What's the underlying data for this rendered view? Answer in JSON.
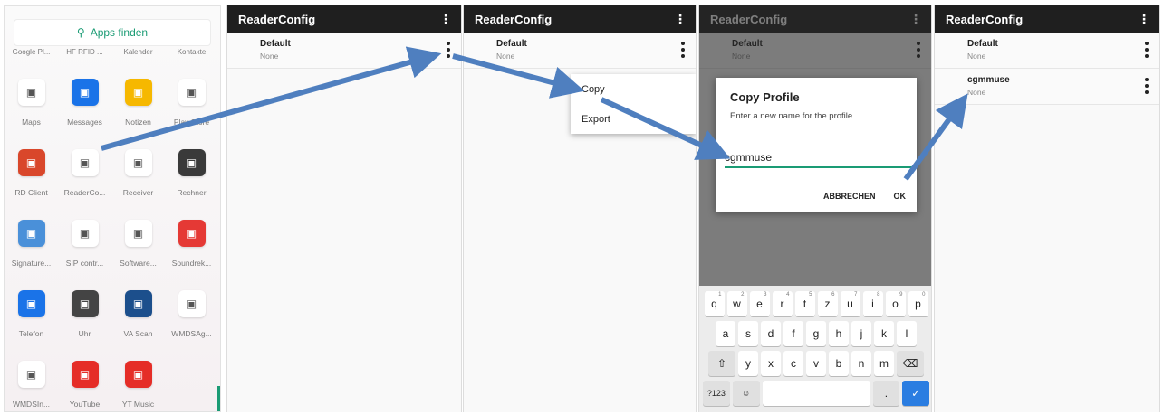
{
  "launcher": {
    "search_label": "Apps finden",
    "top_row": [
      "Google Pl...",
      "HF RFID ...",
      "Kalender",
      "Kontakte"
    ],
    "apps": [
      {
        "label": "Maps",
        "icon": "maps-icon",
        "color": "#ffffff"
      },
      {
        "label": "Messages",
        "icon": "messages-icon",
        "color": "#1a73e8"
      },
      {
        "label": "Notizen",
        "icon": "notes-icon",
        "color": "#f6b800"
      },
      {
        "label": "Play Store",
        "icon": "play-store-icon",
        "color": "#ffffff"
      },
      {
        "label": "RD Client",
        "icon": "rd-client-icon",
        "color": "#d9472b"
      },
      {
        "label": "ReaderCo...",
        "icon": "readerconfig-icon",
        "color": "#ffffff"
      },
      {
        "label": "Receiver",
        "icon": "receiver-icon",
        "color": "#ffffff"
      },
      {
        "label": "Rechner",
        "icon": "calculator-icon",
        "color": "#3a3a3a"
      },
      {
        "label": "Signature...",
        "icon": "signature-icon",
        "color": "#4a90d9"
      },
      {
        "label": "SIP contr...",
        "icon": "sip-icon",
        "color": "#ffffff"
      },
      {
        "label": "Software...",
        "icon": "software-icon",
        "color": "#ffffff"
      },
      {
        "label": "Soundrek...",
        "icon": "recorder-icon",
        "color": "#e53935"
      },
      {
        "label": "Telefon",
        "icon": "phone-icon",
        "color": "#1a73e8"
      },
      {
        "label": "Uhr",
        "icon": "clock-icon",
        "color": "#444444"
      },
      {
        "label": "VA Scan",
        "icon": "va-scan-icon",
        "color": "#1c4f8c"
      },
      {
        "label": "WMDSAg...",
        "icon": "wmds-agent-icon",
        "color": "#ffffff"
      },
      {
        "label": "WMDSIn...",
        "icon": "wmds-installer-icon",
        "color": "#ffffff"
      },
      {
        "label": "YouTube",
        "icon": "youtube-icon",
        "color": "#e52d27"
      },
      {
        "label": "YT Music",
        "icon": "yt-music-icon",
        "color": "#e52d27"
      }
    ]
  },
  "reader_config": {
    "title": "ReaderConfig",
    "default_profile": {
      "name": "Default",
      "sub": "None"
    },
    "new_profile": {
      "name": "cgmmuse",
      "sub": "None"
    }
  },
  "menu": {
    "copy": "Copy",
    "export": "Export"
  },
  "dialog": {
    "title": "Copy Profile",
    "message": "Enter a new name for the profile",
    "input_value": "cgmmuse",
    "cancel": "ABBRECHEN",
    "ok": "OK"
  },
  "keyboard": {
    "row1": [
      [
        "q",
        "1"
      ],
      [
        "w",
        "2"
      ],
      [
        "e",
        "3"
      ],
      [
        "r",
        "4"
      ],
      [
        "t",
        "5"
      ],
      [
        "z",
        "6"
      ],
      [
        "u",
        "7"
      ],
      [
        "i",
        "8"
      ],
      [
        "o",
        "9"
      ],
      [
        "p",
        "0"
      ]
    ],
    "row2": [
      "a",
      "s",
      "d",
      "f",
      "g",
      "h",
      "j",
      "k",
      "l"
    ],
    "row3": [
      "y",
      "x",
      "c",
      "v",
      "b",
      "n",
      "m"
    ],
    "symbols": "?123",
    "period": "."
  },
  "colors": {
    "accent": "#1a9b74",
    "toolbar": "#1f1f1f",
    "arrow": "#4f7fbf"
  }
}
